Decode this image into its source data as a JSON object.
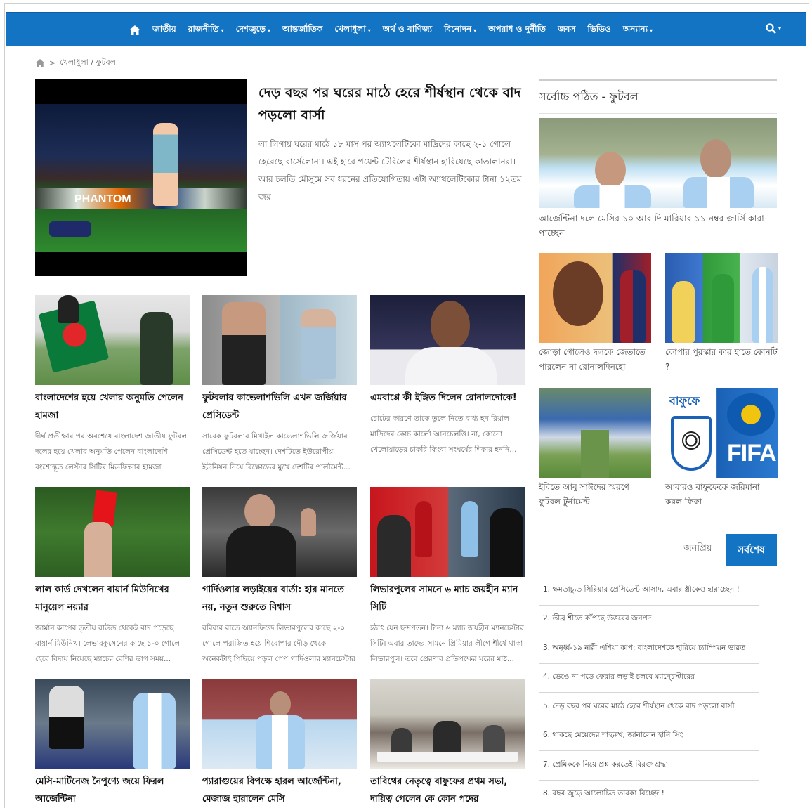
{
  "nav": {
    "items": [
      {
        "label": "জাতীয়",
        "caret": false
      },
      {
        "label": "রাজনীতি",
        "caret": true
      },
      {
        "label": "দেশজুড়ে",
        "caret": true
      },
      {
        "label": "আন্তর্জাতিক",
        "caret": false
      },
      {
        "label": "খেলাধুলা",
        "caret": true
      },
      {
        "label": "অর্থ ও বাণিজ্য",
        "caret": false
      },
      {
        "label": "বিনোদন",
        "caret": true
      },
      {
        "label": "অপরাধ ও দুর্নীতি",
        "caret": false
      },
      {
        "label": "জবস",
        "caret": false
      },
      {
        "label": "ভিডিও",
        "caret": false
      },
      {
        "label": "অন্যান্য",
        "caret": true
      }
    ],
    "caret_glyph": "▾"
  },
  "breadcrumb": {
    "separator": ">",
    "path": "খেলাধুলা / ফুটবল"
  },
  "lead": {
    "title": "দেড় বছর পর ঘরের মাঠে হেরে শীর্ষস্থান থেকে বাদ পড়লো বার্সা",
    "desc": "লা লিগায় ঘরের মাঠে ১৮ মাস পর অ্যাথলেটিকো মাদ্রিদের কাছে ২-১ গোলে হেরেছে বার্সেলোনা। এই হারে পয়েন্ট টেবিলের শীর্ষস্থান হারিয়েছে কাতালানরা। আর চলতি মৌসুমে সব ধরনের প্রতিযোগিতায় এটা অ্যাথলেটিকোর টানা ১২তম জয়।",
    "board_text": "PHANTOM"
  },
  "cards": [
    {
      "title": "বাংলাদেশের হয়ে খেলার অনুমতি পেলেন হামজা",
      "desc": "দীর্ঘ প্রতীক্ষার পর অবশেষে বাংলাদেশ জাতীয় ফুটবল দলের হয়ে খেলার অনুমতি পেলেন বাংলাদেশি বংশোদ্ভূত লেস্টার সিটির মিডফিল্ডার হামজা চৌধুরী..."
    },
    {
      "title": "ফুটবলার কাভেলাশভিলি এখন জর্জিয়ার প্রেসিডেন্ট",
      "desc": "সাবেক ফুটবলার মিখাইল কাভেলাশভিলি জর্জিয়ার প্রেসিডেন্ট হতে যাচ্ছেন। দেশটিতে ইউরোপীয় ইউনিয়ন নিয়ে বিক্ষোভের মুখে দেশটির পার্লামেন্ট..."
    },
    {
      "title": "এমবাপ্পে কী ইঙ্গিত দিলেন রোনালদোকে!",
      "desc": "চোটের কারণে তাকে তুলে নিতে বাধ্য হন রিয়াল মাদ্রিদের কোচ কার্লো আনচেলত্তি। না, কোনো খেলোয়াড়ের চাকরি কিংবা সংঘর্ষের শিকার হননি..."
    },
    {
      "title": "লাল কার্ড দেখলেন বায়ার্ন মিউনিখের মানুয়েল নয়্যার",
      "desc": "জার্মান কাপের তৃতীয় রাউন্ড থেকেই বাদ পড়েছে বায়ার্ন মিউনিখ। লেভারকুসেনের কাছে ১-০ গোলে হেরে বিদায় নিয়েছে ম্যাচের বেশির ভাগ সময়..."
    },
    {
      "title": "গার্দিওলার লড়াইয়ের বার্তা: হার মানতে নয়, নতুন শুরুতে বিশ্বাস",
      "desc": "রবিবার রাতে অ্যানফিল্ডে লিভারপুলের কাছে ২-০ গোলে পরাজিত হয়ে শিরোপার দৌড় থেকে অনেকটাই পিছিয়ে পড়ল পেপ গার্দিওলার ম্যানচেস্টার সিটি। এ..."
    },
    {
      "title": "লিভারপুলের সামনে ৬ ম্যাচ জয়হীন ম্যান সিটি",
      "desc": "হঠাৎ যেন ছন্দপতন। টানা ৬ ম্যাচ জয়হীন ম্যানচেস্টার সিটি। এবার তাদের সামনে প্রিমিয়ার লীগে শীর্ষে থাকা লিভারপুল। তবে প্রেরণার প্রতিপক্ষের ঘরের মাঠ..."
    },
    {
      "title": "মেসি-মার্টিনেজ নৈপুণ্যে জয়ে ফিরল আর্জেন্টিনা",
      "desc": ""
    },
    {
      "title": "প্যারাগুয়ের বিপক্ষে হারল আর্জেন্টিনা, মেজাজ হারালেন মেসি",
      "desc": ""
    },
    {
      "title": "তাবিথের নেতৃত্বে বাফুফের প্রথম সভা, দায়িত্ব পেলেন কে কোন পদের",
      "desc": ""
    }
  ],
  "sidebar": {
    "heading": "সর্বোচ্চ পঠিত - ফুটবল",
    "feature": {
      "title": "আর্জেন্টিনা দলে মেসির ১০ আর দি মারিয়ার ১১ নম্বর জার্সি কারা পাচ্ছেন"
    },
    "small": [
      {
        "title": "জোড়া গোলেও দলকে জেতাতে পারলেন না রোনালদিনহো"
      },
      {
        "title": "কোপার পুরস্কার কার হাতে কোনটি ?"
      },
      {
        "title": "ইবিতে আবু সাঈদের স্মরণে ফুটবল টুর্নামেন্ট"
      },
      {
        "title": "আবারও বাফুফেকে জরিমানা করল ফিফা"
      }
    ],
    "bff_text": "বাফুফে",
    "fifa_text": "FIFA",
    "tabs": {
      "popular": "জনপ্রিয়",
      "latest": "সর্বশেষ"
    },
    "latest": [
      "1. ক্ষমতাচ্যুত সিরিয়ার প্রেসিডেন্ট আসাদ, এবার স্ত্রীকেও হারাচ্ছেন !",
      "2. তীব্র শীতে কাঁপছে উত্তরের জনপদ",
      "3. অনূর্ধ্ব-১৯ নারী এশিয়া কাপ: বাংলাদেশকে হারিয়ে চ্যাম্পিয়ন ভারত",
      "4. ভেঙে না পড়ে ফেরার লড়াই চলবে ম্যান্চেস্টারের",
      "5. দেড় বছর পর ঘরের মাঠে হেরে শীর্ষস্থান থেকে বাদ পড়লো বার্সা",
      "6. থাকছে মেয়েদের শাহরুখ, জানালেন হানি সিং",
      "7. প্রেমিককে নিয়ে প্রশ্ন করতেই বিরক্ত শ্রদ্ধা",
      "8. বছর জুড়ে আলোচিত তারকা বিচ্ছেদ !"
    ]
  },
  "colors": {
    "brand": "#1474c4",
    "text": "#111111",
    "muted": "#666666"
  }
}
